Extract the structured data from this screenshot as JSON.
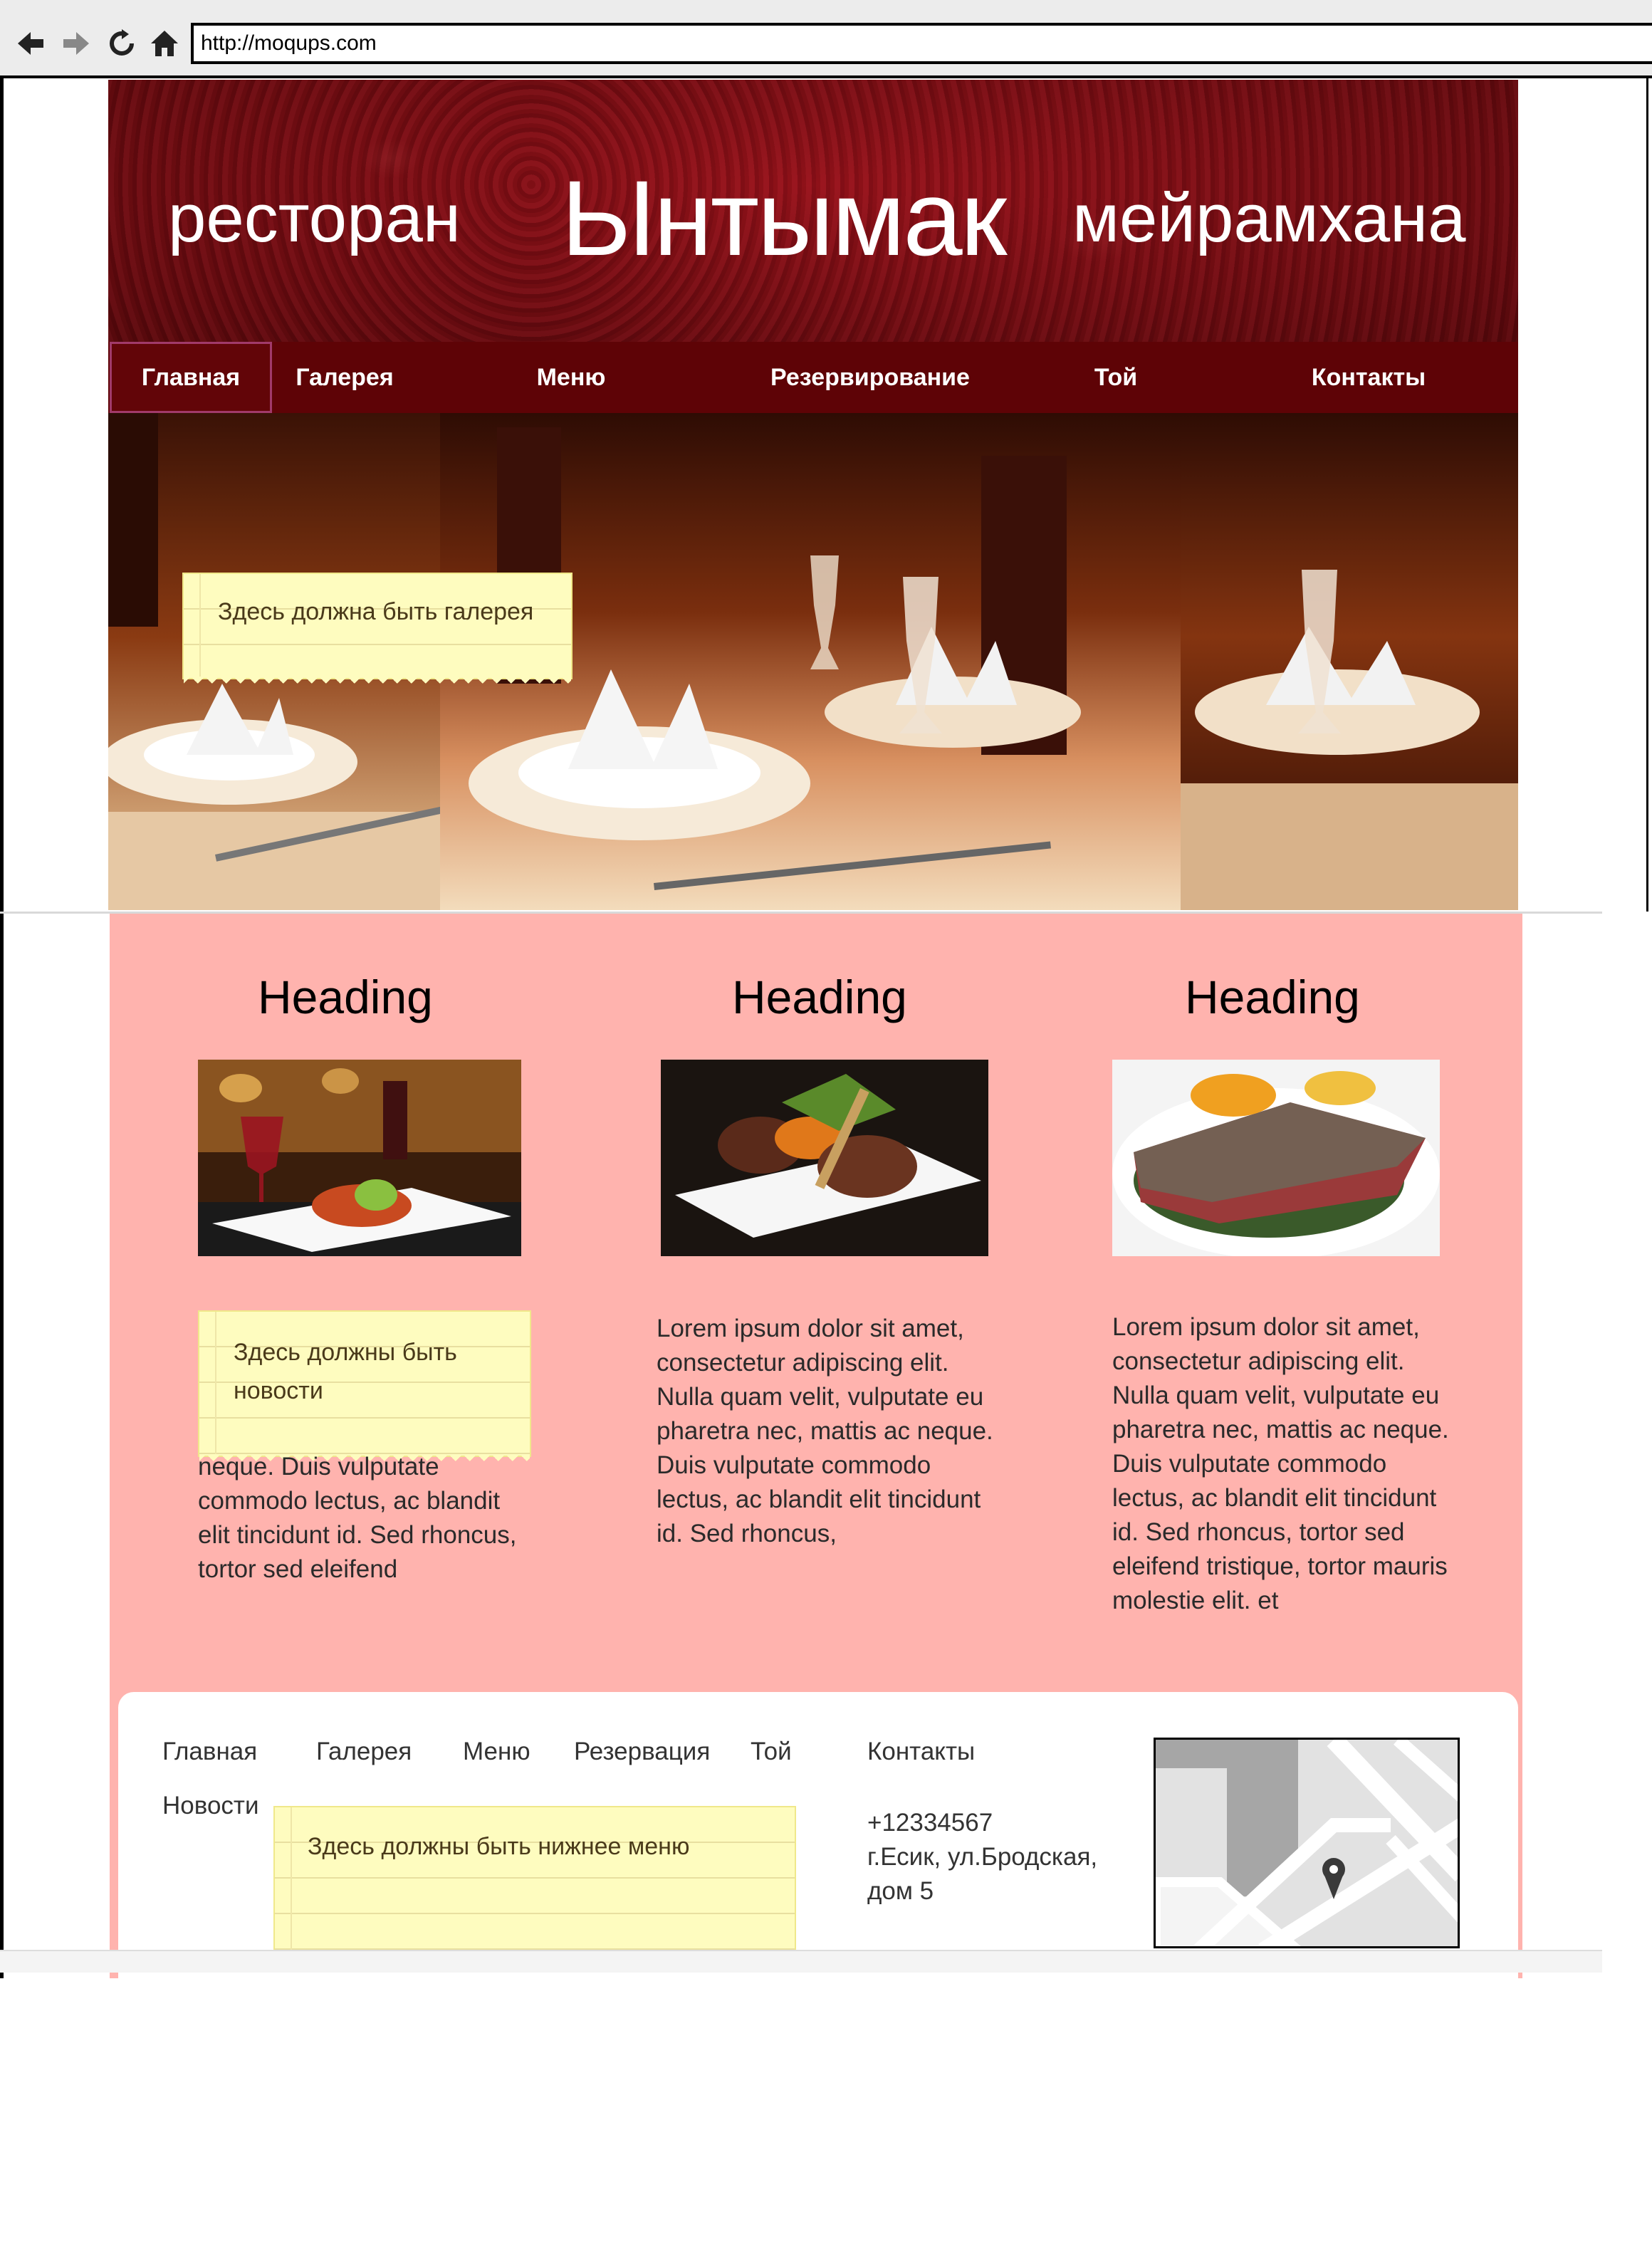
{
  "browser": {
    "url": "http://moqups.com",
    "icons": [
      "back-arrow-icon",
      "forward-arrow-icon",
      "reload-icon",
      "home-icon"
    ]
  },
  "header": {
    "left_word": "ресторан",
    "title": "Ынтымак",
    "right_word": "мейрамхана",
    "background_color": "#7d1218"
  },
  "nav": {
    "background_color": "#5e0306",
    "items": [
      {
        "label": "Главная",
        "active": true
      },
      {
        "label": "Галерея"
      },
      {
        "label": "Меню"
      },
      {
        "label": "Резервирование"
      },
      {
        "label": "Той"
      },
      {
        "label": "Контакты"
      }
    ]
  },
  "hero": {
    "note": "Здесь должна быть галерея"
  },
  "content": {
    "background_color": "#ffb3ae",
    "columns": [
      {
        "heading": "Heading",
        "note": "Здесь должны быть новости",
        "text": "neque. Duis vulputate commodo lectus, ac blandit elit tincidunt id. Sed rhoncus, tortor sed eleifend"
      },
      {
        "heading": "Heading",
        "text": "Lorem ipsum dolor sit amet, consectetur adipiscing elit. Nulla quam velit, vulputate eu pharetra nec, mattis ac neque. Duis vulputate commodo lectus, ac blandit elit tincidunt id. Sed rhoncus,"
      },
      {
        "heading": "Heading",
        "text": "Lorem ipsum dolor sit amet, consectetur adipiscing elit. Nulla quam velit, vulputate eu pharetra nec, mattis ac neque. Duis vulputate commodo lectus, ac blandit elit tincidunt id. Sed rhoncus, tortor sed eleifend tristique, tortor mauris molestie elit. et"
      }
    ]
  },
  "footer": {
    "links": [
      "Главная",
      "Галерея",
      "Меню",
      "Резервация",
      "Той"
    ],
    "news": "Новости",
    "contacts_title": "Контакты",
    "phone": "+12334567",
    "address_line1": "г.Есик, ул.Бродская,",
    "address_line2": "дом 5",
    "note": "Здесь должны быть нижнее меню"
  }
}
